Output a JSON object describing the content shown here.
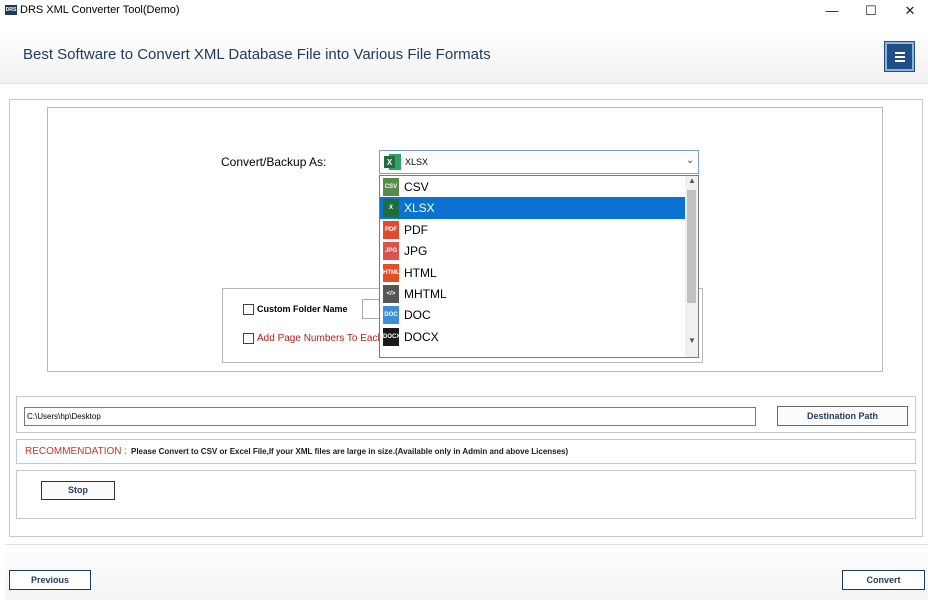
{
  "window": {
    "title": "DRS XML Converter Tool(Demo)",
    "app_icon_text": "DRS",
    "minimize": "—",
    "maximize": "☐",
    "close": "✕"
  },
  "header": {
    "title": "Best Software to Convert XML Database File into Various File Formats",
    "menu_icon": "hamburger-menu-icon"
  },
  "convert": {
    "label": "Convert/Backup As:",
    "selected": "XLSX",
    "options": [
      {
        "label": "CSV",
        "icon": "csv-icon",
        "color": "#5a8a4a",
        "badge": "CSV"
      },
      {
        "label": "XLSX",
        "icon": "excel-icon",
        "color": "#1d6f42",
        "badge": "X"
      },
      {
        "label": "PDF",
        "icon": "pdf-icon",
        "color": "#e04a2f",
        "badge": "PDF"
      },
      {
        "label": "JPG",
        "icon": "jpg-icon",
        "color": "#d9534f",
        "badge": "JPG"
      },
      {
        "label": "HTML",
        "icon": "html-icon",
        "color": "#e44d26",
        "badge": "HTML"
      },
      {
        "label": "MHTML",
        "icon": "mhtml-icon",
        "color": "#555555",
        "badge": "</>"
      },
      {
        "label": "DOC",
        "icon": "doc-icon",
        "color": "#3b8fd6",
        "badge": "DOC"
      },
      {
        "label": "DOCX",
        "icon": "docx-icon",
        "color": "#1a1a1a",
        "badge": "DOCX"
      }
    ]
  },
  "options": {
    "custom_folder_label": "Custom Folder Name",
    "page_numbers_label": "Add Page Numbers To Each"
  },
  "destination": {
    "path": "C:\\Users\\hp\\Desktop",
    "button": "Destination Path"
  },
  "recommendation": {
    "label": "RECOMMENDATION :",
    "text": "Please Convert to CSV or Excel File,If your XML files are large in size.(Available only in Admin and above Licenses)"
  },
  "actions": {
    "stop": "Stop",
    "previous": "Previous",
    "convert": "Convert"
  },
  "colors": {
    "brand": "#1f3a5c",
    "selection": "#0a72d1",
    "warning": "#c0392b"
  }
}
